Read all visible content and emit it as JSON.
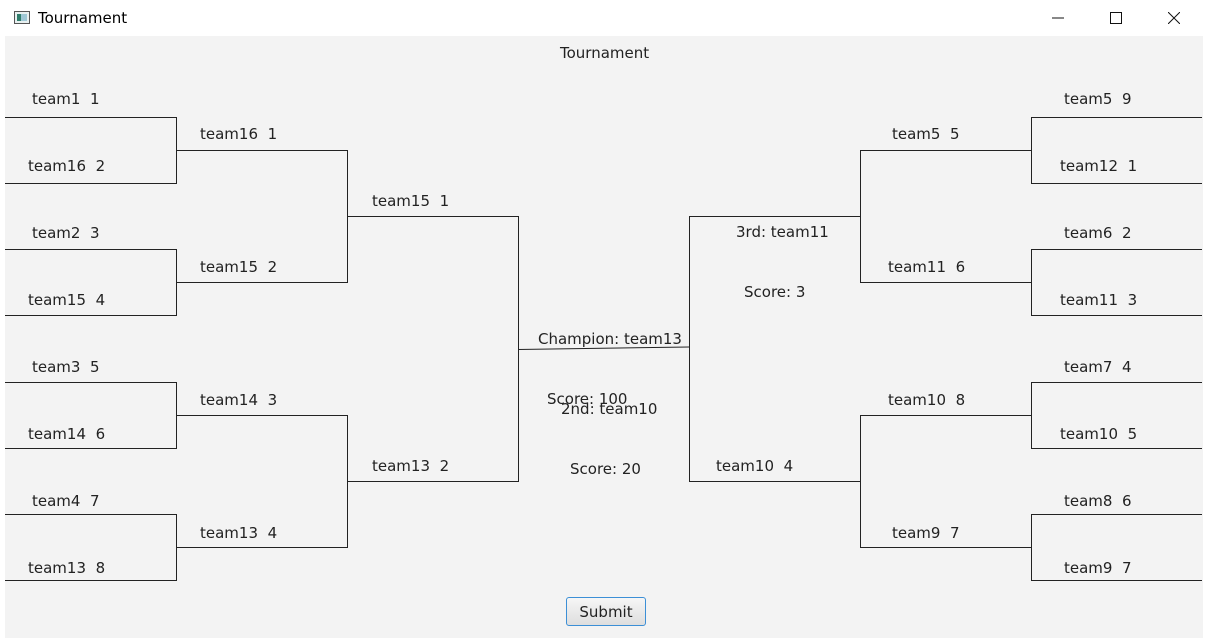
{
  "window": {
    "title": "Tournament",
    "controls": {
      "minimize": "minimize",
      "maximize": "maximize",
      "close": "close"
    }
  },
  "header": {
    "title": "Tournament"
  },
  "round1_left": [
    {
      "team": "team1",
      "score": "1"
    },
    {
      "team": "team16",
      "score": "2"
    },
    {
      "team": "team2",
      "score": "3"
    },
    {
      "team": "team15",
      "score": "4"
    },
    {
      "team": "team3",
      "score": "5"
    },
    {
      "team": "team14",
      "score": "6"
    },
    {
      "team": "team4",
      "score": "7"
    },
    {
      "team": "team13",
      "score": "8"
    }
  ],
  "round2_left": [
    {
      "team": "team16",
      "score": "1"
    },
    {
      "team": "team15",
      "score": "2"
    },
    {
      "team": "team14",
      "score": "3"
    },
    {
      "team": "team13",
      "score": "4"
    }
  ],
  "round3_left": [
    {
      "team": "team15",
      "score": "1"
    },
    {
      "team": "team13",
      "score": "2"
    }
  ],
  "round1_right": [
    {
      "team": "team5",
      "score": "9"
    },
    {
      "team": "team12",
      "score": "1"
    },
    {
      "team": "team6",
      "score": "2"
    },
    {
      "team": "team11",
      "score": "3"
    },
    {
      "team": "team7",
      "score": "4"
    },
    {
      "team": "team10",
      "score": "5"
    },
    {
      "team": "team8",
      "score": "6"
    },
    {
      "team": "team9",
      "score": "7"
    }
  ],
  "round2_right": [
    {
      "team": "team5",
      "score": "5"
    },
    {
      "team": "team11",
      "score": "6"
    },
    {
      "team": "team10",
      "score": "8"
    },
    {
      "team": "team9",
      "score": "7"
    }
  ],
  "round3_right": [
    {
      "team": "team10",
      "score": "4"
    }
  ],
  "third": {
    "label": "3rd: team11",
    "score": "Score: 3"
  },
  "champion": {
    "label": "Champion: team13",
    "score": "Score: 100"
  },
  "second": {
    "label": "2nd: team10",
    "score": "Score: 20"
  },
  "submit_label": "Submit"
}
